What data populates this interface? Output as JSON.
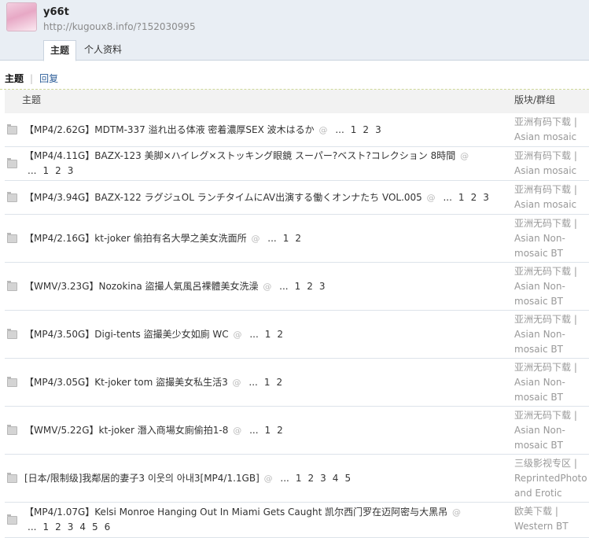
{
  "user": {
    "name": "y66t",
    "url": "http://kugoux8.info/?152030995"
  },
  "tabs": [
    {
      "label": "主题"
    },
    {
      "label": "个人资料"
    }
  ],
  "subnav": {
    "current": "主题",
    "reply": "回复"
  },
  "table": {
    "col_topic": "主题",
    "col_forum": "版块/群组",
    "rows": [
      {
        "title": "【MP4/2.62G】MDTM-337 溢れ出る体液 密着濃厚SEX 波木はるか",
        "ellipsis": "...",
        "pages": [
          "1",
          "2",
          "3"
        ],
        "forum": "亚洲有码下载 | Asian mosaic BT"
      },
      {
        "title": "【MP4/4.11G】BAZX-123 美脚×ハイレグ×ストッキング眼鏡 スーパー?ベスト?コレクション 8時間",
        "ellipsis": "...",
        "pages": [
          "1",
          "2",
          "3"
        ],
        "forum": "亚洲有码下载 | Asian mosaic BT"
      },
      {
        "title": "【MP4/3.94G】BAZX-122 ラグジュOL ランチタイムにAV出演する働くオンナたち VOL.005",
        "ellipsis": "...",
        "pages": [
          "1",
          "2",
          "3"
        ],
        "forum": "亚洲有码下载 | Asian mosaic BT"
      },
      {
        "title": "【MP4/2.16G】kt-joker 偷拍有名大學之美女洗面所",
        "ellipsis": "...",
        "pages": [
          "1",
          "2"
        ],
        "forum": "亚洲无码下载 | Asian Non-mosaic BT"
      },
      {
        "title": "【WMV/3.23G】Nozokina 盜撮人氣風呂裸體美女洗澡",
        "ellipsis": "...",
        "pages": [
          "1",
          "2",
          "3"
        ],
        "forum": "亚洲无码下载 | Asian Non-mosaic BT"
      },
      {
        "title": "【MP4/3.50G】Digi-tents 盜撮美少女如廁 WC",
        "ellipsis": "...",
        "pages": [
          "1",
          "2"
        ],
        "forum": "亚洲无码下载 | Asian Non-mosaic BT"
      },
      {
        "title": "【MP4/3.05G】Kt-joker tom 盜撮美女私生活3",
        "ellipsis": "...",
        "pages": [
          "1",
          "2"
        ],
        "forum": "亚洲无码下载 | Asian Non-mosaic BT"
      },
      {
        "title": "【WMV/5.22G】kt-joker 潛入商場女廁偷拍1-8",
        "ellipsis": "...",
        "pages": [
          "1",
          "2"
        ],
        "forum": "亚洲无码下载 | Asian Non-mosaic BT"
      },
      {
        "title": "[日本/限制级]我鄰居的妻子3 이웃의 아내3[MP4/1.1GB]",
        "ellipsis": "...",
        "pages": [
          "1",
          "2",
          "3",
          "4",
          "5"
        ],
        "forum": "三级影视专区 | ReprintedPhoto and Erotic"
      },
      {
        "title": "【MP4/1.07G】Kelsi Monroe Hanging Out In Miami Gets Caught 凯尔西门罗在迈阿密与大黑吊",
        "ellipsis": "...",
        "pages": [
          "1",
          "2",
          "3",
          "4",
          "5",
          "6"
        ],
        "forum": "欧美下载 | Western BT"
      }
    ]
  }
}
